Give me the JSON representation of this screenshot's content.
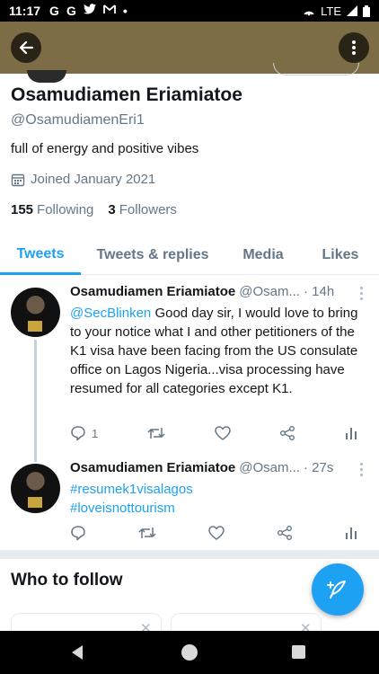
{
  "status_bar": {
    "time": "11:17",
    "notif_icons": [
      "G",
      "G",
      "twitter",
      "M",
      "•"
    ],
    "network": "LTE"
  },
  "profile": {
    "name": "Osamudiamen Eriamiatoe",
    "handle": "@OsamudiamenEri1",
    "bio": "full of energy and positive vibes",
    "joined": "Joined January 2021",
    "following_count": "155",
    "following_label": "Following",
    "followers_count": "3",
    "followers_label": "Followers"
  },
  "tabs": [
    {
      "label": "Tweets",
      "active": true
    },
    {
      "label": "Tweets & replies",
      "active": false
    },
    {
      "label": "Media",
      "active": false
    },
    {
      "label": "Likes",
      "active": false
    }
  ],
  "tweets": [
    {
      "author": "Osamudiamen Eriamiatoe",
      "handle": "@Osam...",
      "time": "· 14h",
      "mention": "@SecBlinken",
      "text": "  Good day sir, I would love to bring to your notice what I and other petitioners of the K1 visa have been facing from the US consulate office on Lagos Nigeria...visa processing have resumed for all categories except K1.",
      "reply_count": "1"
    },
    {
      "author": "Osamudiamen Eriamiatoe",
      "handle": "@Osam...",
      "time": "· 27s",
      "hashtags": [
        "#resumek1visalagos",
        "#loveisnottourism"
      ],
      "reply_count": ""
    }
  ],
  "who_to_follow": {
    "title": "Who to follow"
  },
  "colors": {
    "accent": "#1da1f2",
    "header_bg": "#7d6d46",
    "muted": "#657786"
  }
}
